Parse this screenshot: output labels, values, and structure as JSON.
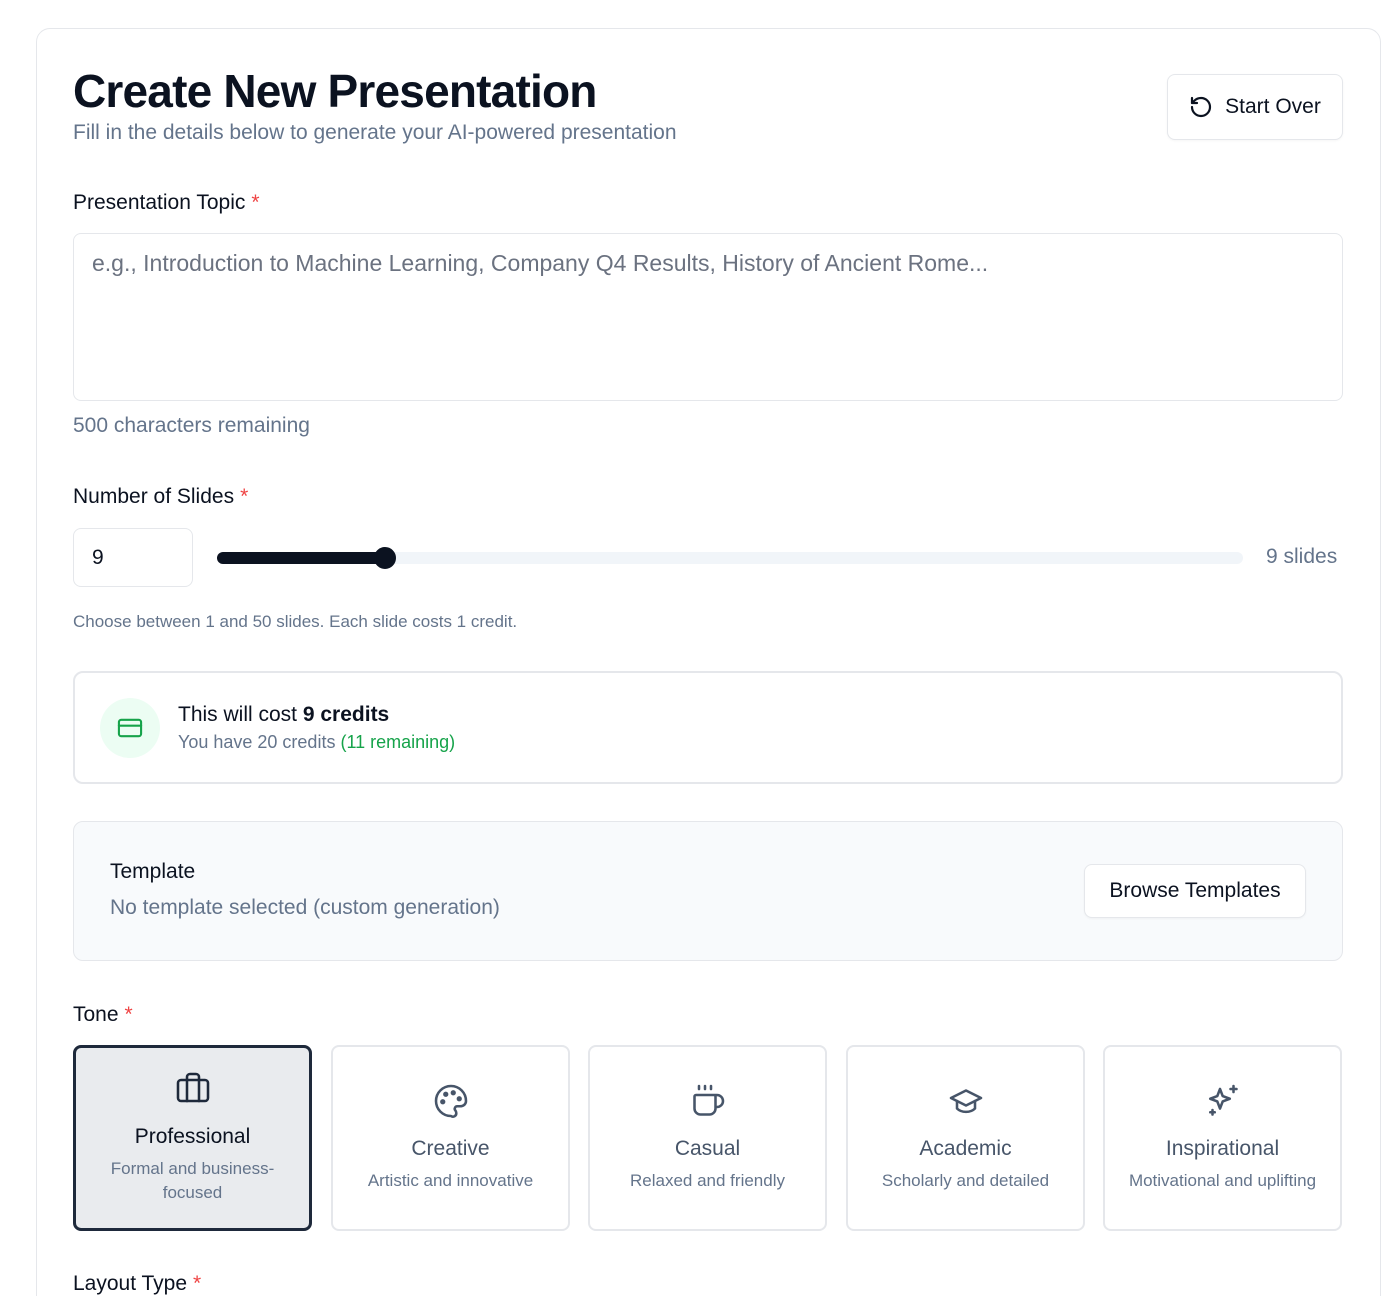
{
  "header": {
    "title": "Create New Presentation",
    "subtitle": "Fill in the details below to generate your AI-powered presentation",
    "start_over_label": "Start Over"
  },
  "topic": {
    "label": "Presentation Topic",
    "required_mark": "*",
    "value": "",
    "placeholder": "e.g., Introduction to Machine Learning, Company Q4 Results, History of Ancient Rome...",
    "chars_remaining": "500 characters remaining"
  },
  "slides": {
    "label": "Number of Slides",
    "required_mark": "*",
    "value": "9",
    "min": 1,
    "max": 50,
    "current": 9,
    "count_label": "9 slides",
    "hint": "Choose between 1 and 50 slides. Each slide costs 1 credit."
  },
  "cost": {
    "title_prefix": "This will cost ",
    "title_bold": "9 credits",
    "sub_prefix": "You have 20 credits ",
    "sub_remaining": "(11 remaining)",
    "icon": "credit-card-icon"
  },
  "template": {
    "title": "Template",
    "subtitle": "No template selected (custom generation)",
    "browse_label": "Browse Templates"
  },
  "tone": {
    "label": "Tone",
    "required_mark": "*",
    "options": [
      {
        "name": "Professional",
        "desc": "Formal and business-focused",
        "icon": "briefcase-icon",
        "selected": true
      },
      {
        "name": "Creative",
        "desc": "Artistic and innovative",
        "icon": "palette-icon",
        "selected": false
      },
      {
        "name": "Casual",
        "desc": "Relaxed and friendly",
        "icon": "coffee-icon",
        "selected": false
      },
      {
        "name": "Academic",
        "desc": "Scholarly and detailed",
        "icon": "graduation-cap-icon",
        "selected": false
      },
      {
        "name": "Inspirational",
        "desc": "Motivational and uplifting",
        "icon": "sparkles-icon",
        "selected": false
      }
    ]
  },
  "layout_type": {
    "label": "Layout Type",
    "required_mark": "*"
  },
  "colors": {
    "primary": "#0b1220",
    "muted": "#64748b",
    "success": "#16a34a",
    "required": "#ef4444",
    "border": "#e5e7eb"
  }
}
